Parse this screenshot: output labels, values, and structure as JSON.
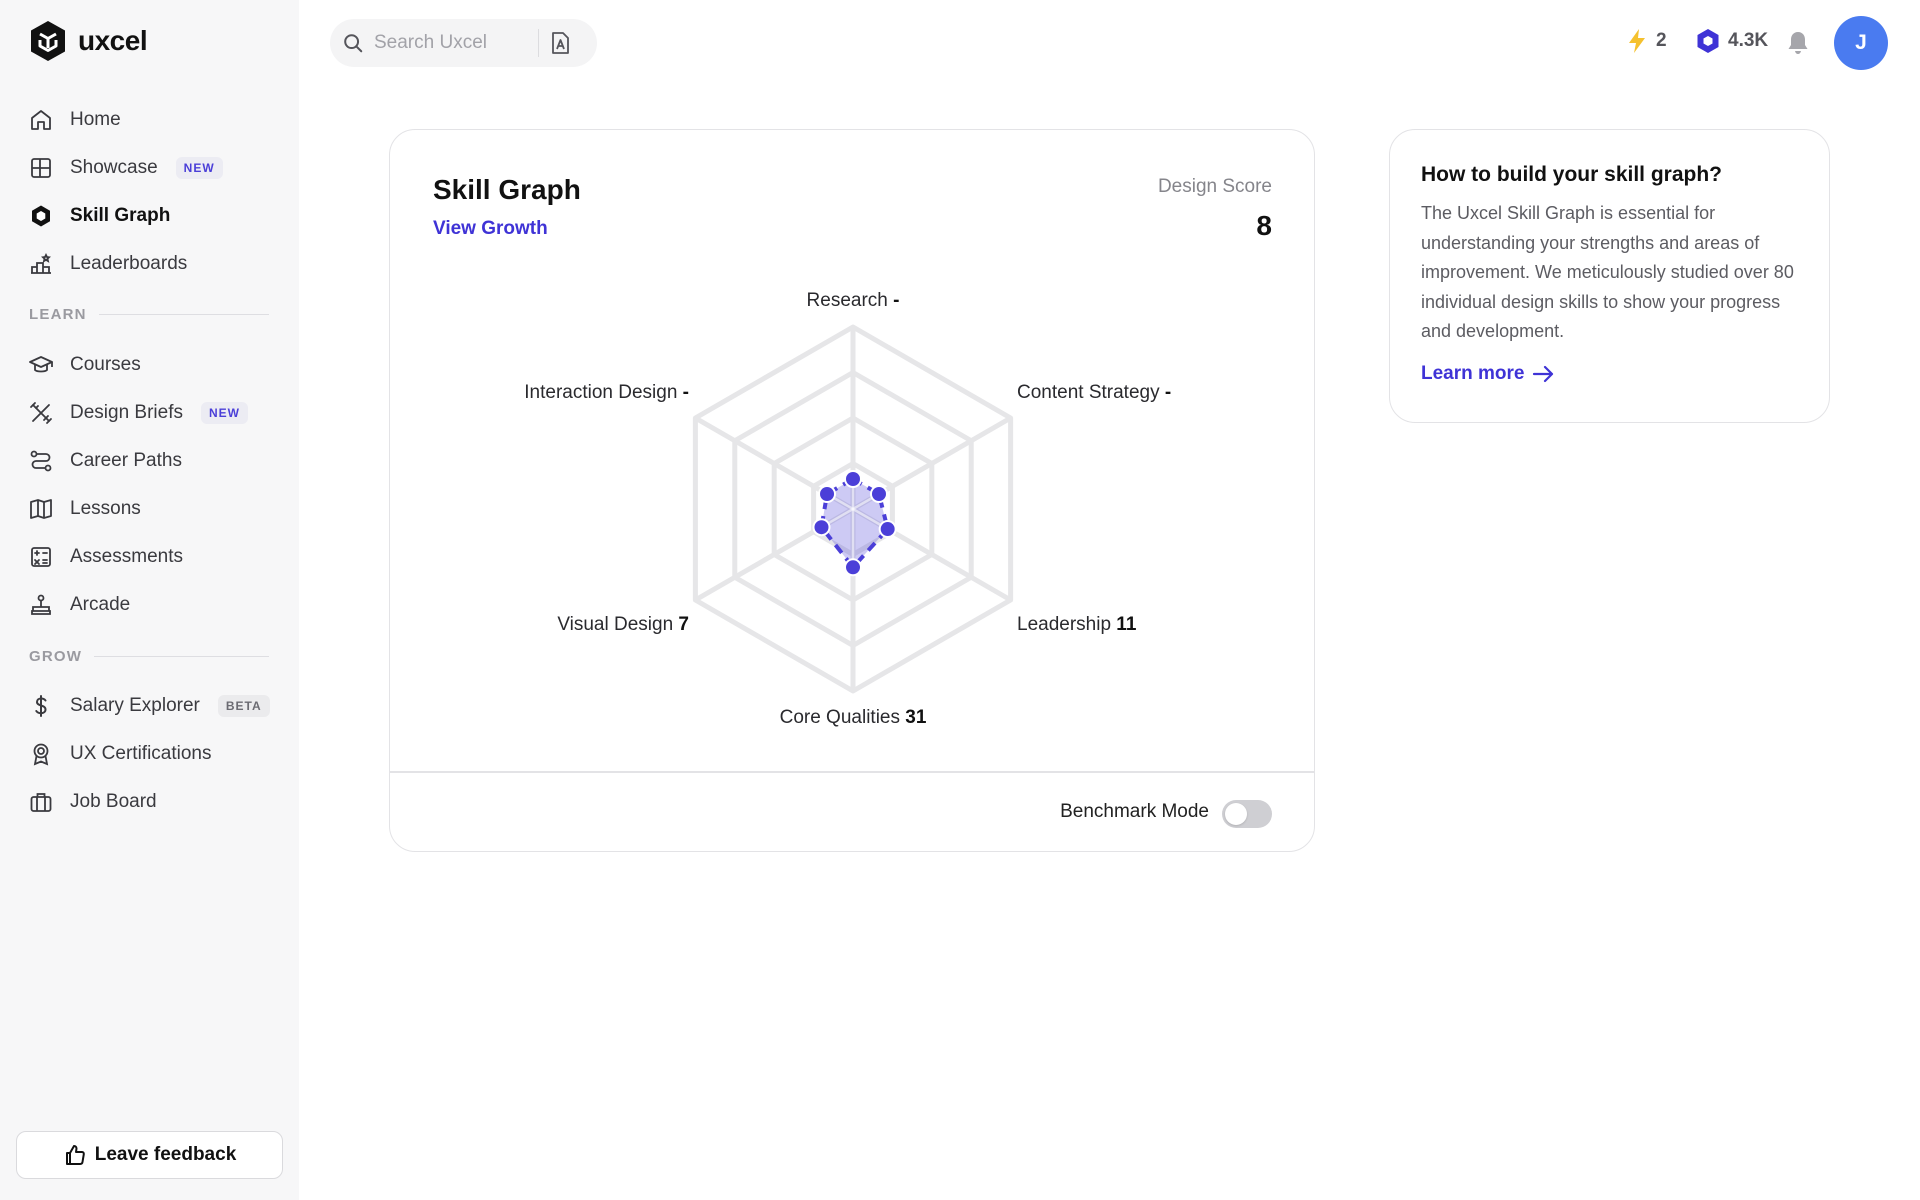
{
  "brand": {
    "name": "uxcel"
  },
  "sidebar": {
    "items": [
      {
        "label": "Home",
        "icon": "home-icon"
      },
      {
        "label": "Showcase",
        "icon": "showcase-icon",
        "badge": "NEW"
      },
      {
        "label": "Skill Graph",
        "icon": "skill-graph-icon",
        "active": true
      },
      {
        "label": "Leaderboards",
        "icon": "leaderboards-icon"
      }
    ],
    "learn_label": "LEARN",
    "learn_items": [
      {
        "label": "Courses",
        "icon": "graduation-cap-icon"
      },
      {
        "label": "Design Briefs",
        "icon": "design-briefs-icon",
        "badge": "NEW"
      },
      {
        "label": "Career Paths",
        "icon": "career-paths-icon"
      },
      {
        "label": "Lessons",
        "icon": "book-icon"
      },
      {
        "label": "Assessments",
        "icon": "assessments-icon"
      },
      {
        "label": "Arcade",
        "icon": "joystick-icon"
      }
    ],
    "grow_label": "GROW",
    "grow_items": [
      {
        "label": "Salary Explorer",
        "icon": "dollar-icon",
        "badge": "BETA"
      },
      {
        "label": "UX Certifications",
        "icon": "certificate-icon"
      },
      {
        "label": "Job Board",
        "icon": "briefcase-icon"
      }
    ],
    "feedback_label": "Leave feedback"
  },
  "topbar": {
    "search_placeholder": "Search Uxcel",
    "streak": "2",
    "points": "4.3K",
    "avatar_initial": "J"
  },
  "skill_card": {
    "title": "Skill Graph",
    "view_growth": "View Growth",
    "score_label": "Design Score",
    "score_value": "8",
    "benchmark_label": "Benchmark Mode",
    "benchmark_on": false
  },
  "chart_data": {
    "type": "radar",
    "axes": [
      {
        "name": "Research",
        "value_label": "-",
        "value": 0
      },
      {
        "name": "Content Strategy",
        "value_label": "-",
        "value": 0
      },
      {
        "name": "Leadership",
        "value_label": "11",
        "value": 11
      },
      {
        "name": "Core Qualities",
        "value_label": "31",
        "value": 31
      },
      {
        "name": "Visual Design",
        "value_label": "7",
        "value": 7
      },
      {
        "name": "Interaction Design",
        "value_label": "-",
        "value": 0
      }
    ],
    "rings": 4,
    "accent": "#4b3fd8",
    "grid_color": "#e6e6e8"
  },
  "info_card": {
    "title": "How to build your skill graph?",
    "body": "The Uxcel Skill Graph is essential for understanding your strengths and areas of improvement. We meticulously studied over 80 individual design skills to show your progress and development.",
    "link": "Learn more"
  }
}
